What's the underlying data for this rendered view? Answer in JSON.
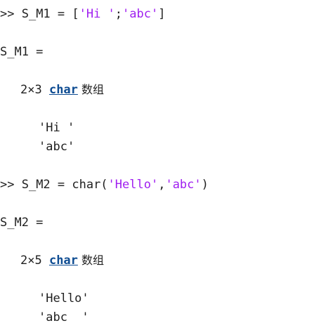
{
  "console": {
    "cmd1": {
      "prompt": ">> ",
      "lhs": "S_M1 = [",
      "s1": "'Hi '",
      "sep": ";",
      "s2": "'abc'",
      "close": "]"
    },
    "out1": {
      "var_line": "S_M1 =",
      "size": "2×3 ",
      "type_link": "char",
      "array_word": " 数组",
      "rows": [
        "'Hi '",
        "'abc'"
      ]
    },
    "cmd2": {
      "prompt": ">> ",
      "lhs": "S_M2 = char(",
      "s1": "'Hello'",
      "sep": ",",
      "s2": "'abc'",
      "close": ")"
    },
    "out2": {
      "var_line": "S_M2 =",
      "size": "2×5 ",
      "type_link": "char",
      "array_word": " 数组",
      "rows": [
        "'Hello'",
        "'abc  '"
      ]
    }
  }
}
